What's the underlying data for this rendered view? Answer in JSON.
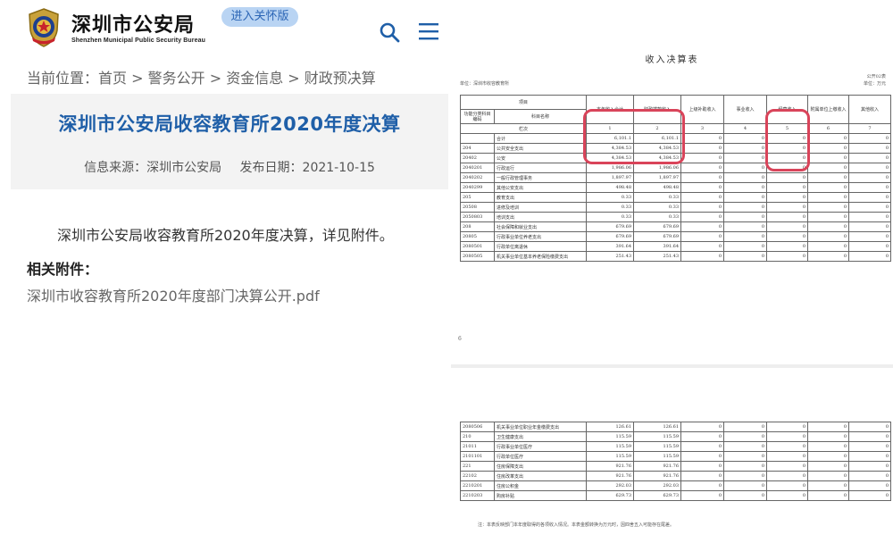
{
  "header": {
    "site_name": "深圳市公安局",
    "site_name_en": "Shenzhen Municipal Public Security Bureau",
    "care_button": "进入关怀版"
  },
  "breadcrumb": {
    "prefix": "当前位置：",
    "items": [
      "首页",
      "警务公开",
      "资金信息",
      "财政预决算"
    ],
    "separator": " > "
  },
  "article": {
    "title": "深圳市公安局收容教育所2020年度决算",
    "source": "信息来源：深圳市公安局",
    "date": "发布日期：2021-10-15",
    "body": "深圳市公安局收容教育所2020年度决算，详见附件。",
    "attachments_heading": "相关附件：",
    "attachment": "深圳市收容教育所2020年度部门决算公开.pdf"
  },
  "document": {
    "title": "收入决算表",
    "unit": "单位：深圳市收容教育所",
    "form_code": "公开02表",
    "money_unit": "单位：万元",
    "page_number": "6",
    "header_top": [
      "项目",
      "",
      "本年收入合计",
      "财政拨款收入",
      "上级补助收入",
      "事业收入",
      "经营收入",
      "附属单位上缴收入",
      "其他收入"
    ],
    "header_cols": [
      "功能分类科目编码",
      "科目名称"
    ],
    "col_numbers": [
      "栏次",
      "1",
      "2",
      "3",
      "4",
      "5",
      "6",
      "7"
    ],
    "rows": [
      [
        "",
        "合计",
        "6,101.1",
        "6,101.1",
        "0",
        "0",
        "0",
        "0",
        "0"
      ],
      [
        "204",
        "公共安全支出",
        "4,384.53",
        "4,384.53",
        "0",
        "0",
        "0",
        "0",
        "0"
      ],
      [
        "20402",
        "公安",
        "4,384.53",
        "4,384.53",
        "0",
        "0",
        "0",
        "0",
        "0"
      ],
      [
        "2040201",
        "行政运行",
        "1,986.06",
        "1,986.06",
        "0",
        "0",
        "0",
        "0",
        "0"
      ],
      [
        "2040202",
        "一般行政管理事务",
        "1,897.97",
        "1,897.97",
        "0",
        "0",
        "0",
        "0",
        "0"
      ],
      [
        "2040299",
        "其他公安支出",
        "498.48",
        "498.48",
        "0",
        "0",
        "0",
        "0",
        "0"
      ],
      [
        "205",
        "教育支出",
        "0.33",
        "0.33",
        "0",
        "0",
        "0",
        "0",
        "0"
      ],
      [
        "20508",
        "进修及培训",
        "0.33",
        "0.33",
        "0",
        "0",
        "0",
        "0",
        "0"
      ],
      [
        "2050803",
        "培训支出",
        "0.33",
        "0.33",
        "0",
        "0",
        "0",
        "0",
        "0"
      ],
      [
        "208",
        "社会保障和就业支出",
        "679.69",
        "679.69",
        "0",
        "0",
        "0",
        "0",
        "0"
      ],
      [
        "20805",
        "行政事业单位养老支出",
        "679.69",
        "679.69",
        "0",
        "0",
        "0",
        "0",
        "0"
      ],
      [
        "2080501",
        "行政单位离退休",
        "391.64",
        "391.64",
        "0",
        "0",
        "0",
        "0",
        "0"
      ],
      [
        "2080505",
        "机关事业单位基本养老保险缴费支出",
        "251.43",
        "251.43",
        "0",
        "0",
        "0",
        "0",
        "0"
      ]
    ],
    "rows2": [
      [
        "2080506",
        "机关事业单位职业年金缴费支出",
        "126.61",
        "126.61",
        "0",
        "0",
        "0",
        "0",
        "0"
      ],
      [
        "210",
        "卫生健康支出",
        "115.59",
        "115.59",
        "0",
        "0",
        "0",
        "0",
        "0"
      ],
      [
        "21011",
        "行政事业单位医疗",
        "115.59",
        "115.59",
        "0",
        "0",
        "0",
        "0",
        "0"
      ],
      [
        "2101101",
        "行政单位医疗",
        "115.59",
        "115.59",
        "0",
        "0",
        "0",
        "0",
        "0"
      ],
      [
        "221",
        "住房保障支出",
        "921.76",
        "921.76",
        "0",
        "0",
        "0",
        "0",
        "0"
      ],
      [
        "22102",
        "住房改革支出",
        "921.76",
        "921.76",
        "0",
        "0",
        "0",
        "0",
        "0"
      ],
      [
        "2210201",
        "住房公积金",
        "292.03",
        "292.03",
        "0",
        "0",
        "0",
        "0",
        "0"
      ],
      [
        "2210203",
        "购房补贴",
        "629.73",
        "629.73",
        "0",
        "0",
        "0",
        "0",
        "0"
      ]
    ],
    "note": "注：本表反映部门本年度取得的各项收入情况。本表金额转换为万元时，因四舍五入可能存在尾差。"
  },
  "colors": {
    "accent": "#1f5fa8",
    "highlight": "#d9445a",
    "care_bg": "#b9d4f3"
  },
  "icons": {
    "search": "search-icon",
    "menu": "menu-icon",
    "emblem": "police-emblem-icon"
  }
}
